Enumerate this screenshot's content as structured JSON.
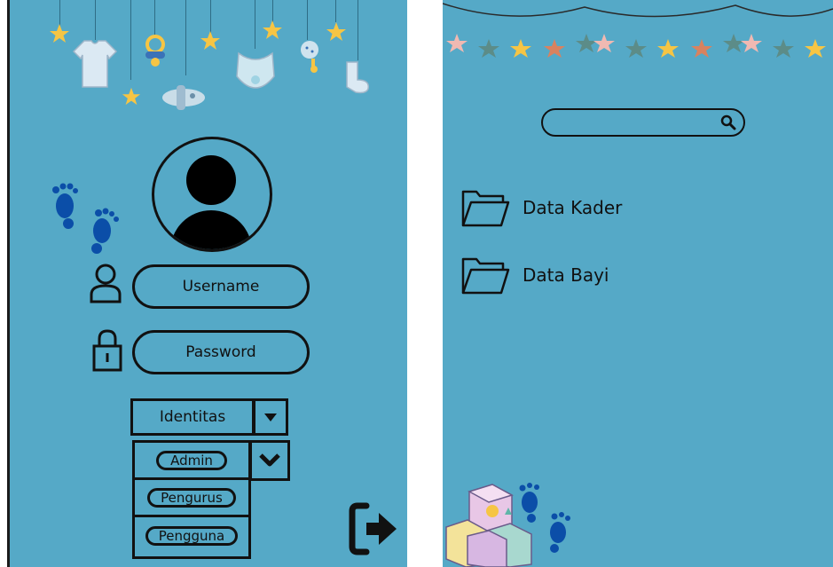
{
  "login": {
    "username_label": "Username",
    "password_label": "Password",
    "identity_label": "Identitas",
    "options": [
      "Admin",
      "Pengurus",
      "Pengguna"
    ]
  },
  "menu": {
    "items": [
      {
        "label": "Data Kader"
      },
      {
        "label": "Data Bayi"
      }
    ]
  },
  "colors": {
    "background": "#55a9c7",
    "outline": "#111111",
    "star_yellow": "#f6c544",
    "star_pink": "#f0b9b2",
    "star_teal": "#5c8c88",
    "star_orange": "#d9825f",
    "footprint_blue": "#0b4ea8"
  },
  "icons": {
    "user": "user-outline-icon",
    "lock": "padlock-icon",
    "logout": "logout-icon",
    "search": "search-icon",
    "folder": "folder-open-icon"
  }
}
